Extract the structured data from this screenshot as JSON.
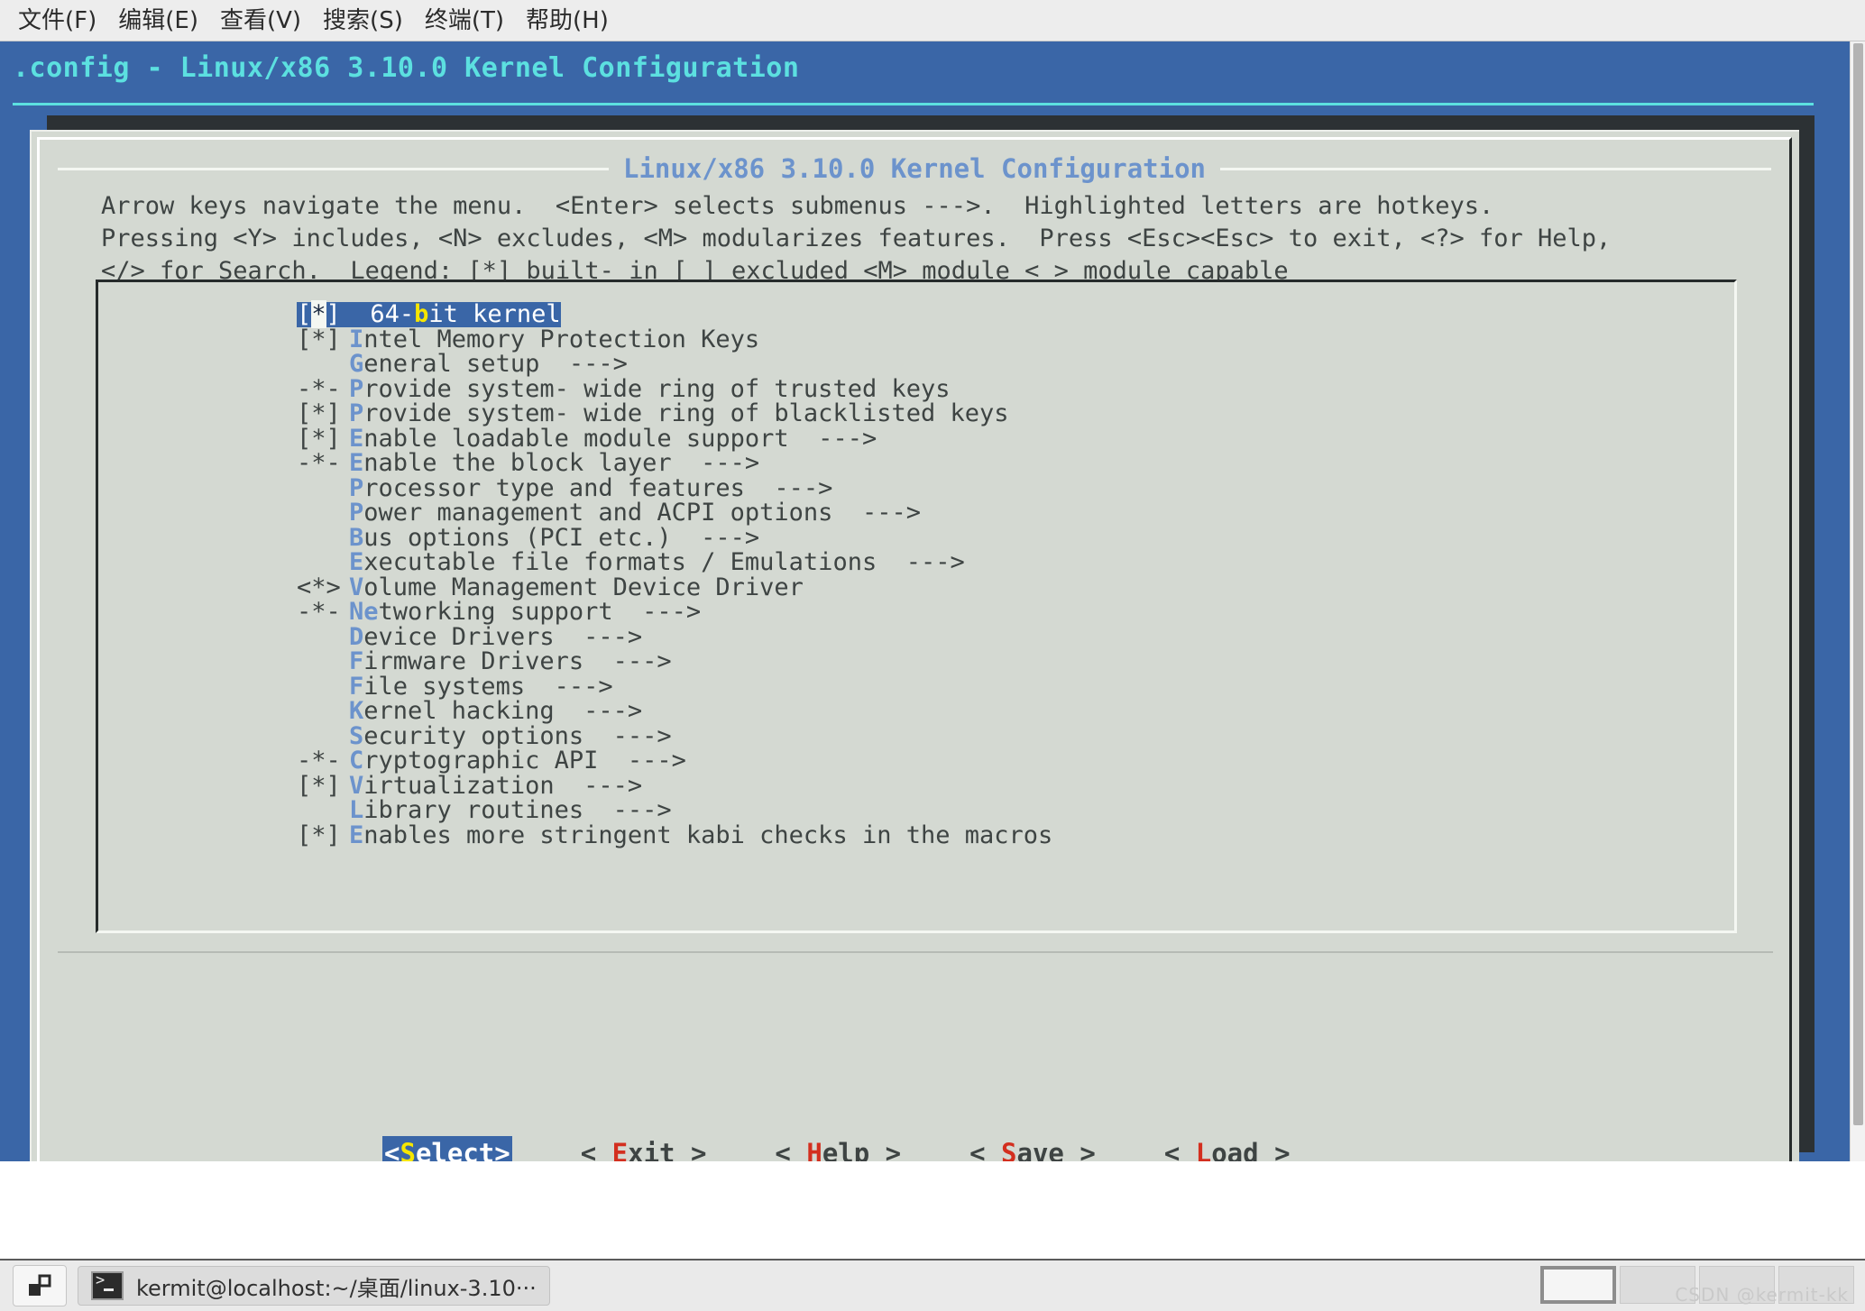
{
  "menubar": {
    "items": [
      {
        "label": "文件(F)",
        "name": "menu-file"
      },
      {
        "label": "编辑(E)",
        "name": "menu-edit"
      },
      {
        "label": "查看(V)",
        "name": "menu-view"
      },
      {
        "label": "搜索(S)",
        "name": "menu-search"
      },
      {
        "label": "终端(T)",
        "name": "menu-terminal"
      },
      {
        "label": "帮助(H)",
        "name": "menu-help"
      }
    ]
  },
  "terminal": {
    "title": ".config - Linux/x86 3.10.0 Kernel Configuration"
  },
  "dialog": {
    "heading": "Linux/x86 3.10.0 Kernel Configuration",
    "help_lines": [
      "Arrow keys navigate the menu.  <Enter> selects submenus --->.  Highlighted letters are hotkeys.",
      "Pressing <Y> includes, <N> excludes, <M> modularizes features.  Press <Esc><Esc> to exit, <?> for Help,",
      "</> for Search.  Legend: [*] built- in [ ] excluded <M> module < > module capable"
    ]
  },
  "menu": {
    "selected_index": 0,
    "items": [
      {
        "tag": "[*]",
        "hot": "b",
        "pre": "64-",
        "post": "it kernel",
        "suffix": "",
        "selected": true
      },
      {
        "tag": "[*]",
        "hot": "I",
        "pre": "",
        "post": "ntel Memory Protection Keys",
        "suffix": ""
      },
      {
        "tag": "   ",
        "hot": "G",
        "pre": "",
        "post": "eneral setup",
        "suffix": "  --->"
      },
      {
        "tag": "-*-",
        "hot": "P",
        "pre": "",
        "post": "rovide system- wide ring of trusted keys",
        "suffix": ""
      },
      {
        "tag": "[*]",
        "hot": "P",
        "pre": "",
        "post": "rovide system- wide ring of blacklisted keys",
        "suffix": ""
      },
      {
        "tag": "[*]",
        "hot": "E",
        "pre": "",
        "post": "nable loadable module support",
        "suffix": "  --->"
      },
      {
        "tag": "-*-",
        "hot": "E",
        "pre": "",
        "post": "nable the block layer",
        "suffix": "  --->"
      },
      {
        "tag": "   ",
        "hot": "P",
        "pre": "",
        "post": "rocessor type and features",
        "suffix": "  --->"
      },
      {
        "tag": "   ",
        "hot": "P",
        "pre": "",
        "post": "ower management and ACPI options",
        "suffix": "  --->"
      },
      {
        "tag": "   ",
        "hot": "B",
        "pre": "",
        "post": "us options (PCI etc.)",
        "suffix": "  --->"
      },
      {
        "tag": "   ",
        "hot": "E",
        "pre": "",
        "post": "xecutable file formats / Emulations",
        "suffix": "  --->"
      },
      {
        "tag": "<*>",
        "hot": "V",
        "pre": "",
        "post": "olume Management Device Driver",
        "suffix": ""
      },
      {
        "tag": "-*-",
        "hot": "Ne",
        "pre": "",
        "post": "tworking support",
        "suffix": "  --->"
      },
      {
        "tag": "   ",
        "hot": "D",
        "pre": "",
        "post": "evice Drivers",
        "suffix": "  --->"
      },
      {
        "tag": "   ",
        "hot": "F",
        "pre": "",
        "post": "irmware Drivers",
        "suffix": "  --->"
      },
      {
        "tag": "   ",
        "hot": "F",
        "pre": "",
        "post": "ile systems",
        "suffix": "  --->"
      },
      {
        "tag": "   ",
        "hot": "K",
        "pre": "",
        "post": "ernel hacking",
        "suffix": "  --->"
      },
      {
        "tag": "   ",
        "hot": "S",
        "pre": "",
        "post": "ecurity options",
        "suffix": "  --->"
      },
      {
        "tag": "-*-",
        "hot": "C",
        "pre": "",
        "post": "ryptographic API",
        "suffix": "  --->"
      },
      {
        "tag": "[*]",
        "hot": "V",
        "pre": "",
        "post": "irtualization",
        "suffix": "  --->"
      },
      {
        "tag": "   ",
        "hot": "L",
        "pre": "",
        "post": "ibrary routines",
        "suffix": "  --->"
      },
      {
        "tag": "[*]",
        "hot": "E",
        "pre": "",
        "post": "nables more stringent kabi checks in the macros",
        "suffix": ""
      }
    ]
  },
  "buttons": [
    {
      "name": "select-button",
      "left": "<",
      "hot": "S",
      "rest": "elect",
      "right": ">",
      "active": true
    },
    {
      "name": "exit-button",
      "left": "< ",
      "hot": "E",
      "rest": "xit",
      "right": " >",
      "active": false
    },
    {
      "name": "help-button",
      "left": "< ",
      "hot": "H",
      "rest": "elp",
      "right": " >",
      "active": false
    },
    {
      "name": "save-button",
      "left": "< ",
      "hot": "S",
      "rest": "ave",
      "right": " >",
      "active": false
    },
    {
      "name": "load-button",
      "left": "< ",
      "hot": "L",
      "rest": "oad",
      "right": " >",
      "active": false
    }
  ],
  "taskbar": {
    "show_desktop_icon": "show-desktop-icon",
    "task_label": "kermit@localhost:~/桌面/linux-3.10···",
    "pager_cells": 4,
    "pager_active": 0
  },
  "watermark": "CSDN @kermit-kk",
  "colors": {
    "terminal_blue": "#3a66a7",
    "dialog_bg": "#d4d9d2",
    "title_cyan": "#5ce0e0",
    "heading_blue": "#6c93cc",
    "hotkey_blue": "#6c93cc",
    "hotkey_yellow": "#f6e600",
    "button_hotkey_red": "#d32f1f",
    "terminal_dark": "#2c3134"
  }
}
